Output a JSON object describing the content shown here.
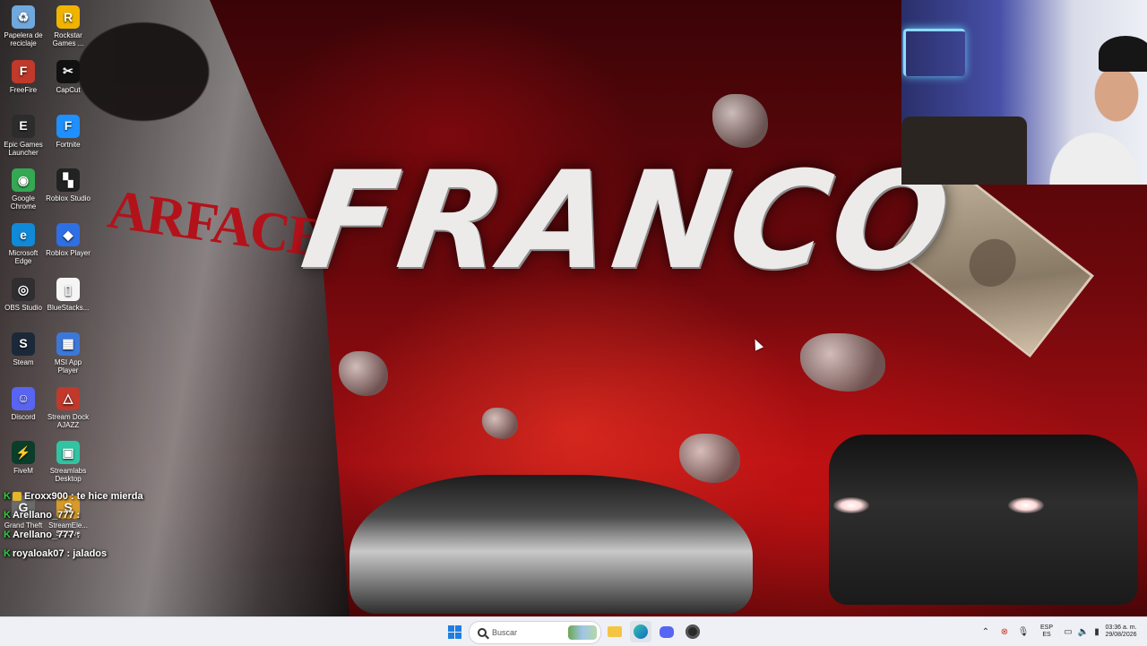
{
  "wallpaper": {
    "title": "FRANCO",
    "jacket_text": "ARFACE",
    "accent": "#b3121a"
  },
  "desktop_icons": [
    {
      "label": "Papelera de reciclaje",
      "icon": "recycle-bin-icon",
      "glyph": "♻",
      "color": "#6fa8dc"
    },
    {
      "label": "Rockstar Games ...",
      "icon": "rockstar-icon",
      "glyph": "R",
      "color": "#f0b400"
    },
    {
      "label": "FreeFire",
      "icon": "freefire-icon",
      "glyph": "F",
      "color": "#c0392b"
    },
    {
      "label": "CapCut",
      "icon": "capcut-icon",
      "glyph": "✂",
      "color": "#111111"
    },
    {
      "label": "Epic Games Launcher",
      "icon": "epic-games-icon",
      "glyph": "E",
      "color": "#2c2c2c"
    },
    {
      "label": "Fortnite",
      "icon": "fortnite-icon",
      "glyph": "F",
      "color": "#1e90ff"
    },
    {
      "label": "Google Chrome",
      "icon": "chrome-icon",
      "glyph": "◉",
      "color": "#34a853"
    },
    {
      "label": "Roblox Studio",
      "icon": "roblox-studio-icon",
      "glyph": "▚",
      "color": "#222222"
    },
    {
      "label": "Microsoft Edge",
      "icon": "edge-icon",
      "glyph": "e",
      "color": "#0f8ad8"
    },
    {
      "label": "Roblox Player",
      "icon": "roblox-player-icon",
      "glyph": "◆",
      "color": "#2f6fe4"
    },
    {
      "label": "OBS Studio",
      "icon": "obs-icon",
      "glyph": "◎",
      "color": "#302e31"
    },
    {
      "label": "BlueStacks...",
      "icon": "bluestacks-icon",
      "glyph": "▯",
      "color": "#f5f5f5"
    },
    {
      "label": "Steam",
      "icon": "steam-icon",
      "glyph": "S",
      "color": "#1b2838"
    },
    {
      "label": "MSI App Player",
      "icon": "msi-app-player-icon",
      "glyph": "▦",
      "color": "#3c78d8"
    },
    {
      "label": "Discord",
      "icon": "discord-icon",
      "glyph": "☺",
      "color": "#5865f2"
    },
    {
      "label": "Stream Dock AJAZZ",
      "icon": "stream-dock-icon",
      "glyph": "△",
      "color": "#c0392b"
    },
    {
      "label": "FiveM",
      "icon": "fivem-icon",
      "glyph": "⚡",
      "color": "#0a3d2a"
    },
    {
      "label": "Streamlabs Desktop",
      "icon": "streamlabs-icon",
      "glyph": "▣",
      "color": "#31c3a2"
    },
    {
      "label": "Grand Theft",
      "icon": "gta-icon",
      "glyph": "G",
      "color": "#6b6b6b"
    },
    {
      "label": "StreamEle... SE.Live",
      "icon": "streamelements-icon",
      "glyph": "S",
      "color": "#d79b2b"
    }
  ],
  "chat": [
    {
      "user": "Eroxx900",
      "message": "te hice mierda"
    },
    {
      "user": "Arellano_777",
      "message": ""
    },
    {
      "user": "Arellano_777",
      "message": ""
    },
    {
      "user": "royaloak07",
      "message": "jalados"
    }
  ],
  "taskbar": {
    "search_placeholder": "Buscar",
    "language_top": "ESP",
    "language_bottom": "ES",
    "time": "03:36 a. m.",
    "date": "29/08/2026"
  }
}
